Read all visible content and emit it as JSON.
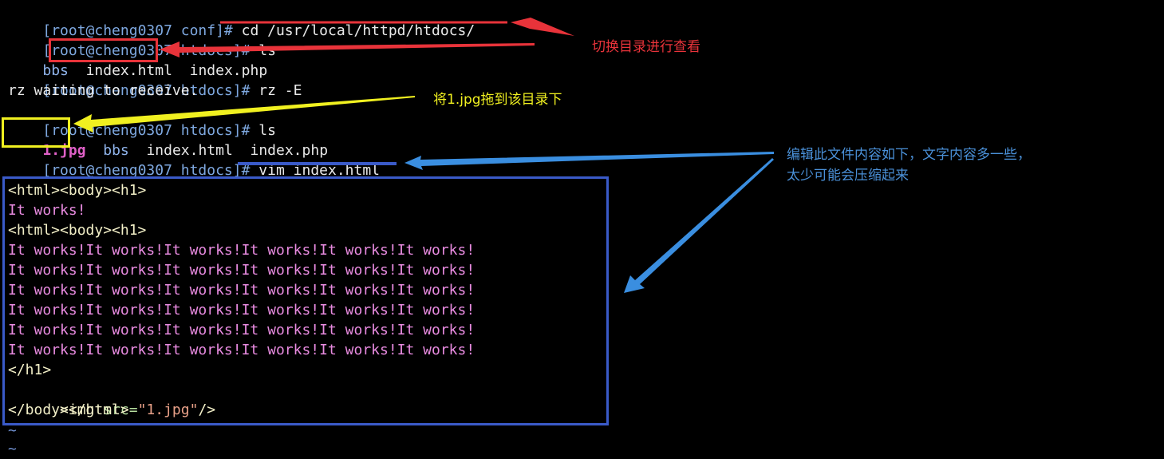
{
  "terminal": {
    "lines": [
      {
        "prompt": "[root@cheng0307 conf]# ",
        "command": "cd /usr/local/httpd/htdocs/"
      },
      {
        "prompt": "[root@cheng0307 htdocs]# ",
        "command": "ls"
      },
      {
        "listing": [
          "bbs",
          "index.html",
          "index.php"
        ]
      },
      {
        "prompt": "[root@cheng0307 htdocs]# ",
        "command": "rz -E"
      },
      {
        "output": "rz waiting to receive."
      },
      {
        "prompt": "[root@cheng0307 htdocs]# ",
        "command": "ls"
      },
      {
        "listing": [
          "1.jpg",
          "bbs",
          "index.html",
          "index.php"
        ]
      },
      {
        "prompt": "[root@cheng0307 htdocs]# ",
        "command": "vim index.html"
      }
    ],
    "vim": {
      "lines": [
        "<html><body><h1>",
        "It works!",
        "<html><body><h1>",
        "It works!It works!It works!It works!It works!It works!",
        "It works!It works!It works!It works!It works!It works!",
        "It works!It works!It works!It works!It works!It works!",
        "It works!It works!It works!It works!It works!It works!",
        "It works!It works!It works!It works!It works!It works!",
        "It works!It works!It works!It works!It works!It works!",
        "</h1>",
        "<img src=\"1.jpg\"/>",
        "</body></html>"
      ],
      "img_tag": {
        "open": "<img ",
        "attr": "src=",
        "value": "\"1.jpg\"",
        "close": "/>"
      },
      "tildes": [
        "~",
        "~"
      ]
    }
  },
  "annotations": {
    "switch_dir": {
      "text": "切换目录进行查看",
      "color": "#e8333a"
    },
    "drag_jpg": {
      "text": "将1.jpg拖到该目录下",
      "color": "#f0f020"
    },
    "edit_file": {
      "line1": "编辑此文件内容如下，文字内容多一些，",
      "line2": "太少可能会压缩起来",
      "color": "#4a90d8"
    }
  },
  "colors": {
    "red": "#e8333a",
    "yellow": "#f0f020",
    "blue_arrow": "#3a8ee0",
    "blue_box": "#3a5ac8"
  }
}
